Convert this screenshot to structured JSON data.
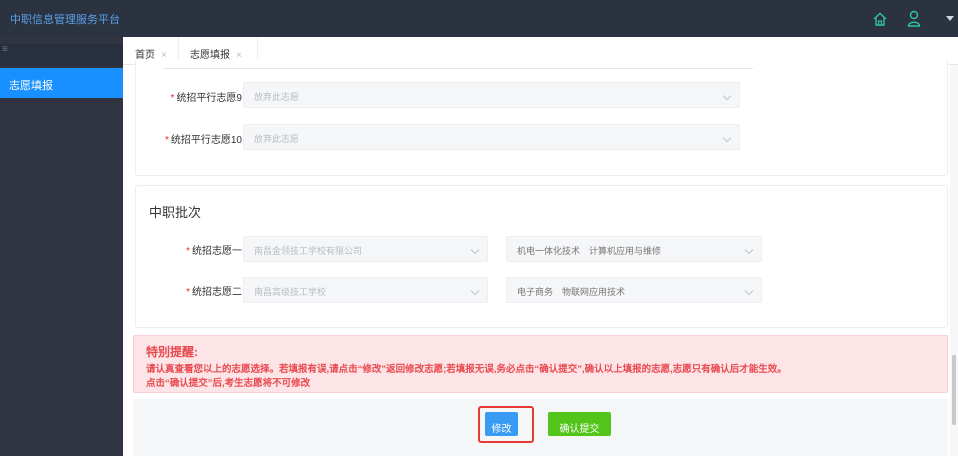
{
  "app": {
    "title": "中职信息管理服务平台"
  },
  "sidebar": {
    "collapse_label": "≡",
    "items": [
      {
        "label": "志愿填报",
        "active": true
      }
    ]
  },
  "tabs": [
    {
      "label": "首页",
      "close": "×"
    },
    {
      "label": "志愿填报",
      "close": "×",
      "active": true
    }
  ],
  "parallel_section": {
    "fields": [
      {
        "label": "统招平行志愿9",
        "placeholder": "放弃此志愿"
      },
      {
        "label": "统招平行志愿10",
        "placeholder": "放弃此志愿"
      }
    ]
  },
  "vocational_section": {
    "title": "中职批次",
    "fields": [
      {
        "label": "统招志愿一",
        "school": "南昌金领技工学校有限公司",
        "major": "机电一体化技术",
        "minor": "计算机应用与维修"
      },
      {
        "label": "统招志愿二",
        "school": "南昌高级技工学校",
        "major": "电子商务",
        "minor": "物联网应用技术"
      }
    ]
  },
  "notice": {
    "title": "特别提醒:",
    "line1": "请认真查看您以上的志愿选择。若填报有误,请点击“修改”返回修改志愿;若填报无误,务必点击“确认提交”,确认以上填报的志愿,志愿只有确认后才能生效。",
    "line2": "点击“确认提交”后,考生志愿将不可修改"
  },
  "actions": {
    "edit_label": "修改",
    "submit_label": "确认提交"
  },
  "colors": {
    "accent": "#1890ff",
    "success": "#52c41a",
    "danger": "#e8494f",
    "topbar": "#2b3240"
  },
  "icons": {
    "home": "home-icon",
    "user": "user-icon",
    "dropdown": "chevron-down-icon"
  }
}
